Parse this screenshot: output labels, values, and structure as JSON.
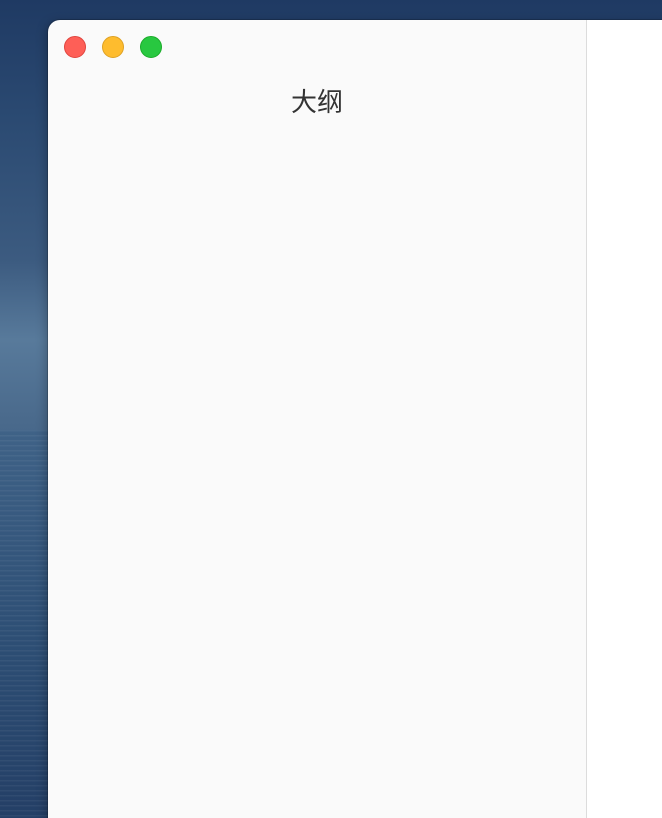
{
  "window": {
    "controls": [
      {
        "name": "close",
        "icon": "close-icon",
        "color": "#fe5f57"
      },
      {
        "name": "minimize",
        "icon": "minimize-icon",
        "color": "#febc2e"
      },
      {
        "name": "zoom",
        "icon": "zoom-icon",
        "color": "#28c840"
      }
    ]
  },
  "sidebar": {
    "title": "大纲",
    "background": "#fafafa"
  },
  "content": {
    "background": "#ffffff"
  }
}
